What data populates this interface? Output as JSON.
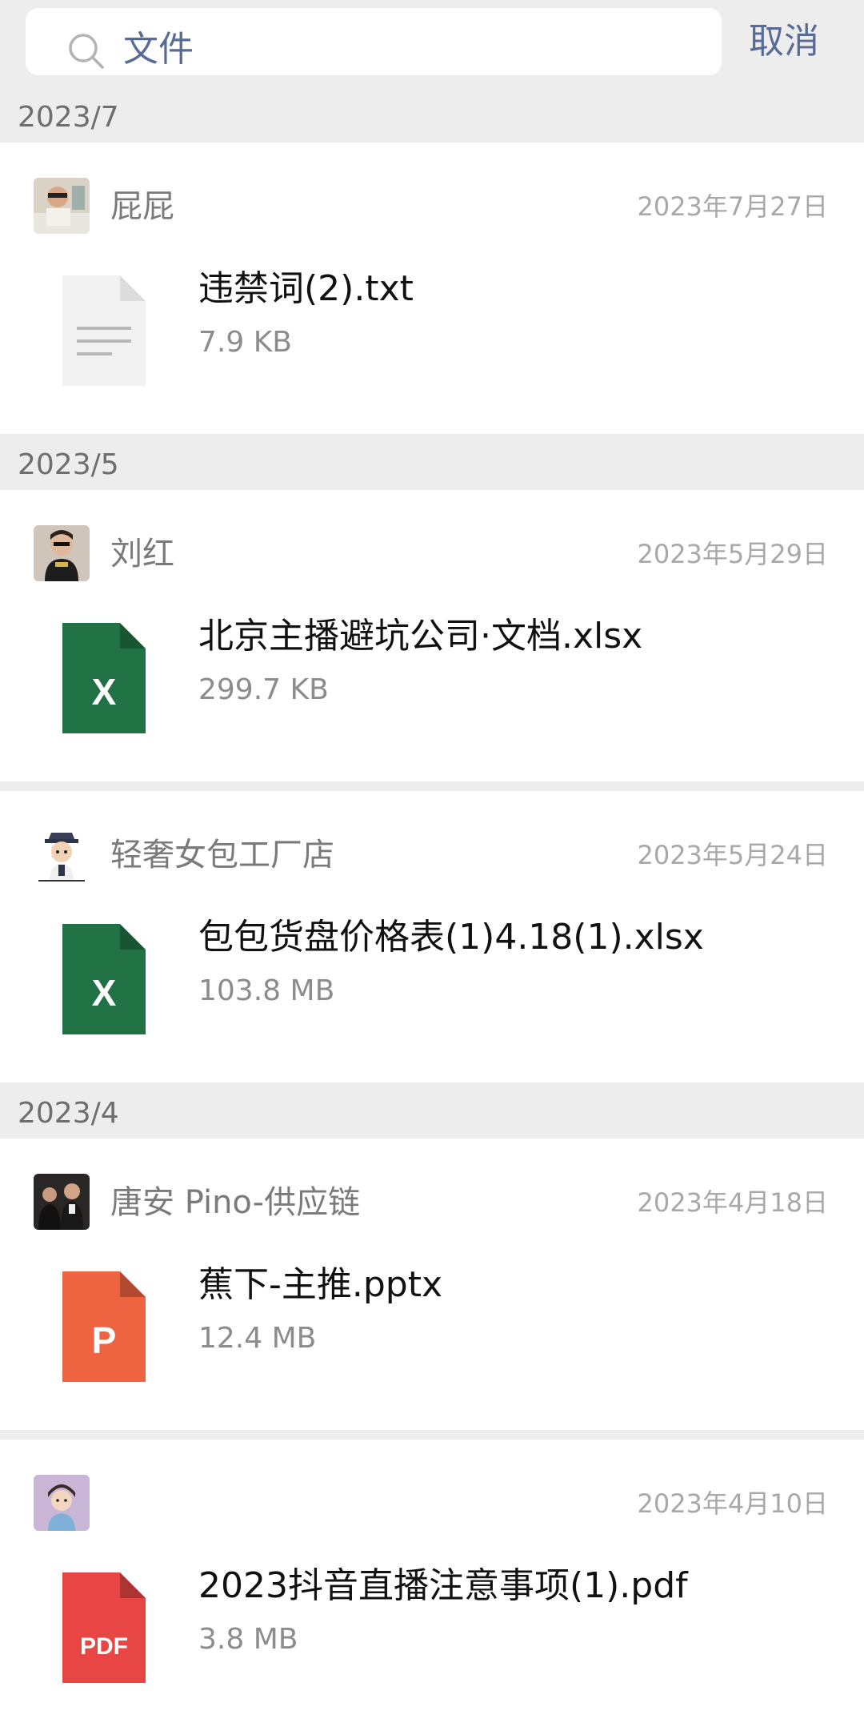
{
  "search": {
    "query": "文件",
    "cancel_label": "取消"
  },
  "groups": [
    {
      "header": "2023/7",
      "items": [
        {
          "sender": "屁屁",
          "date": "2023年7月27日",
          "file_name": "违禁词(2).txt",
          "file_size": "7.9 KB",
          "file_type": "txt",
          "icon_label": ""
        }
      ]
    },
    {
      "header": "2023/5",
      "items": [
        {
          "sender": "刘红",
          "date": "2023年5月29日",
          "file_name": "北京主播避坑公司·文档.xlsx",
          "file_size": "299.7 KB",
          "file_type": "xlsx",
          "icon_label": "X"
        },
        {
          "sender": "轻奢女包工厂店",
          "date": "2023年5月24日",
          "file_name": "包包货盘价格表(1)4.18(1).xlsx",
          "file_size": "103.8 MB",
          "file_type": "xlsx",
          "icon_label": "X"
        }
      ]
    },
    {
      "header": "2023/4",
      "items": [
        {
          "sender": "唐安 Pino-供应链",
          "date": "2023年4月18日",
          "file_name": "蕉下-主推.pptx",
          "file_size": "12.4 MB",
          "file_type": "pptx",
          "icon_label": "P"
        },
        {
          "sender": "",
          "date": "2023年4月10日",
          "file_name": "2023抖音直播注意事项(1).pdf",
          "file_size": "3.8 MB",
          "file_type": "pdf",
          "icon_label": "PDF"
        }
      ]
    }
  ],
  "colors": {
    "accent": "#576b95",
    "xlsx": "#207245",
    "pptx": "#ee6340",
    "pdf": "#e84545",
    "txt": "#f2f2f2"
  }
}
